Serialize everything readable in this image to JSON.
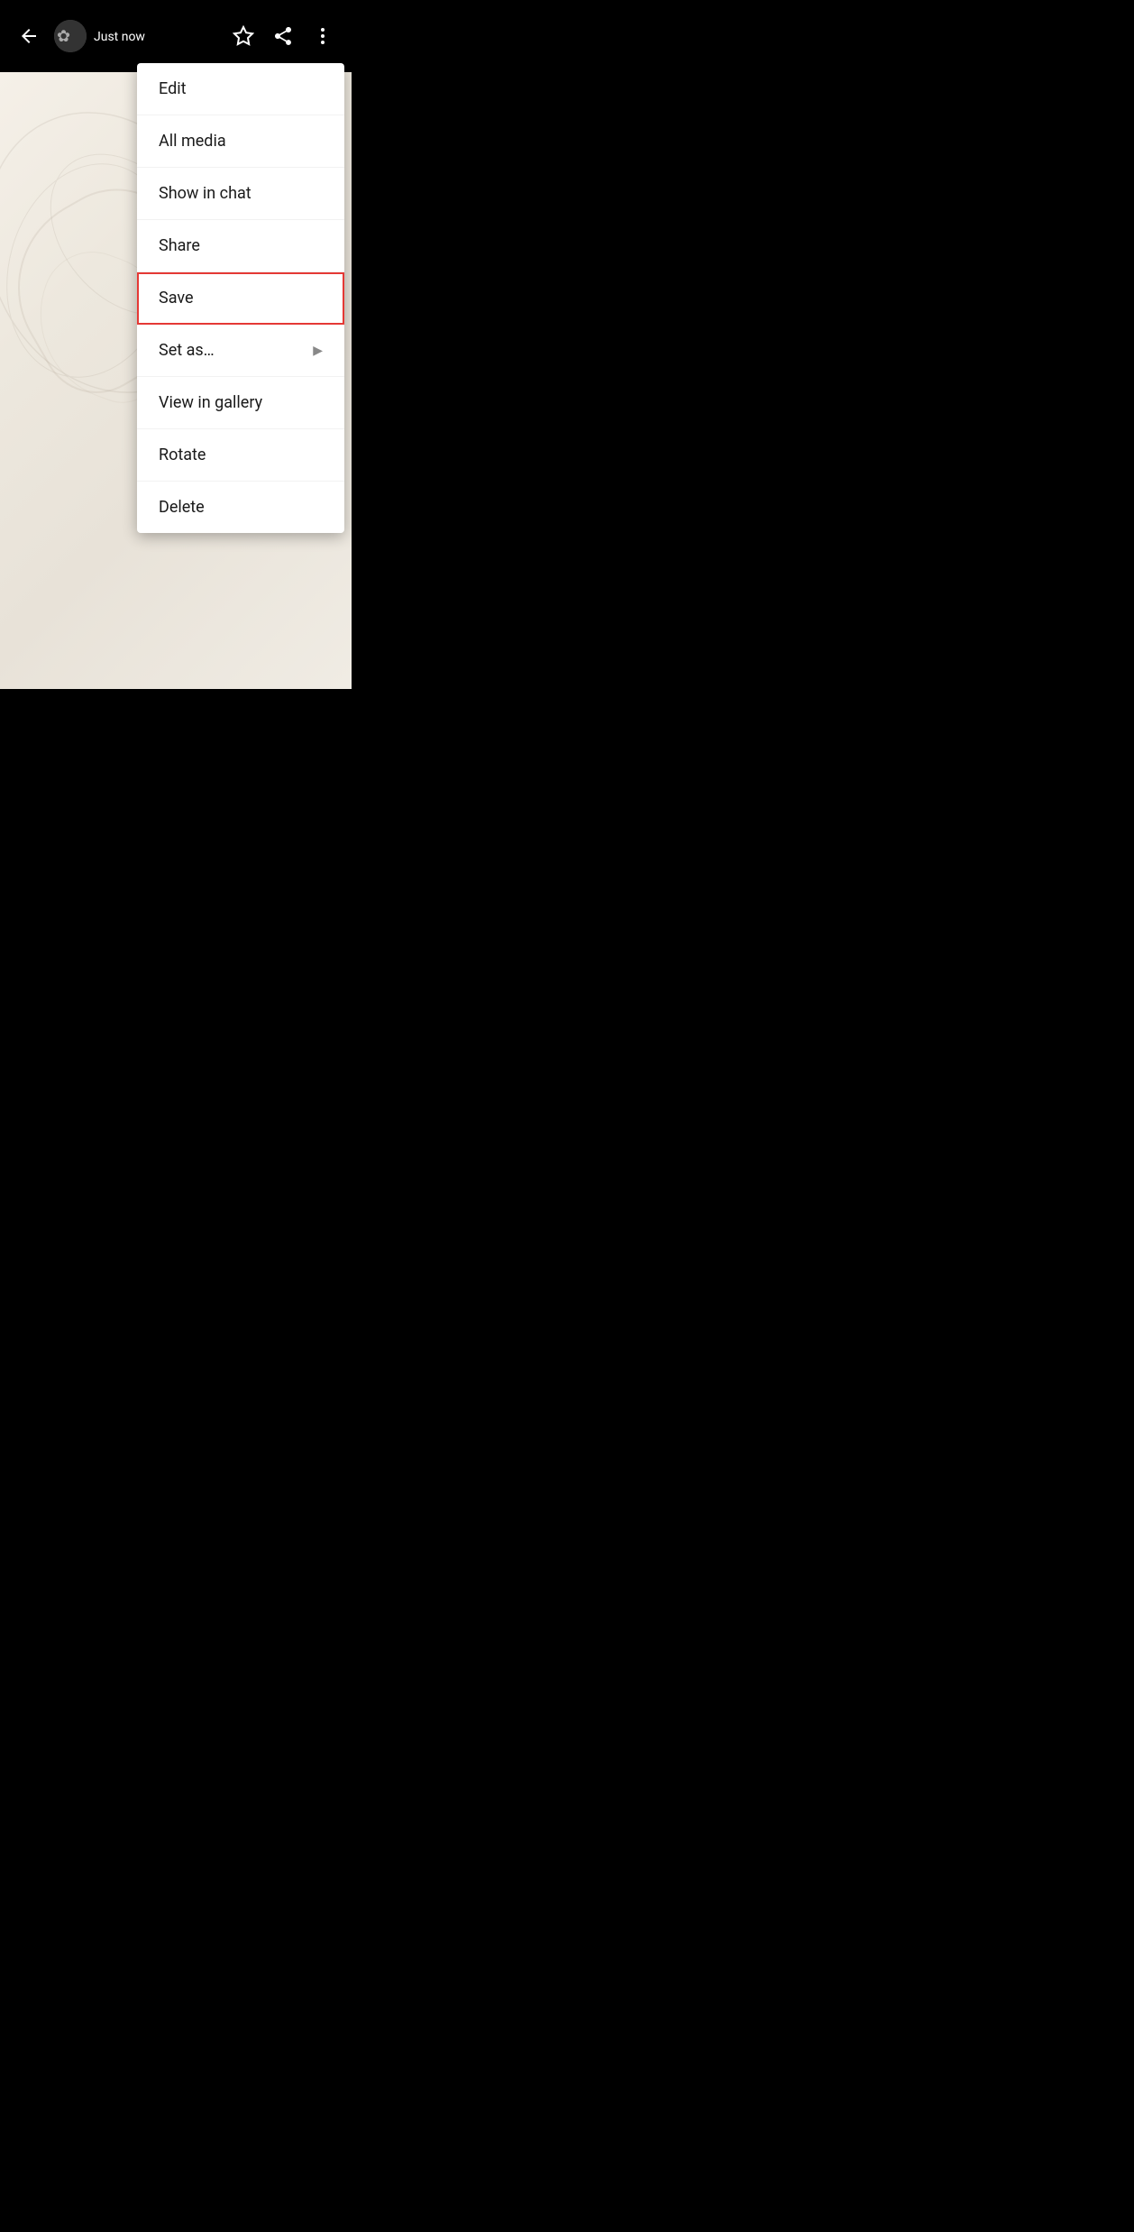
{
  "topbar": {
    "back_label": "←",
    "timestamp": "Just now",
    "star_icon": "star-outline",
    "forward_icon": "forward",
    "more_icon": "more-vertical"
  },
  "menu": {
    "items": [
      {
        "id": "edit",
        "label": "Edit",
        "has_arrow": false,
        "highlighted": false
      },
      {
        "id": "all_media",
        "label": "All media",
        "has_arrow": false,
        "highlighted": false
      },
      {
        "id": "show_in_chat",
        "label": "Show in chat",
        "has_arrow": false,
        "highlighted": false
      },
      {
        "id": "share",
        "label": "Share",
        "has_arrow": false,
        "highlighted": false
      },
      {
        "id": "save",
        "label": "Save",
        "has_arrow": false,
        "highlighted": true
      },
      {
        "id": "set_as",
        "label": "Set as…",
        "has_arrow": true,
        "highlighted": false
      },
      {
        "id": "view_in_gallery",
        "label": "View in gallery",
        "has_arrow": false,
        "highlighted": false
      },
      {
        "id": "rotate",
        "label": "Rotate",
        "has_arrow": false,
        "highlighted": false
      },
      {
        "id": "delete",
        "label": "Delete",
        "has_arrow": false,
        "highlighted": false
      }
    ]
  },
  "colors": {
    "topbar_bg": "#000000",
    "menu_bg": "#ffffff",
    "highlight_border": "#e53935",
    "text_primary": "#1a1a1a"
  }
}
